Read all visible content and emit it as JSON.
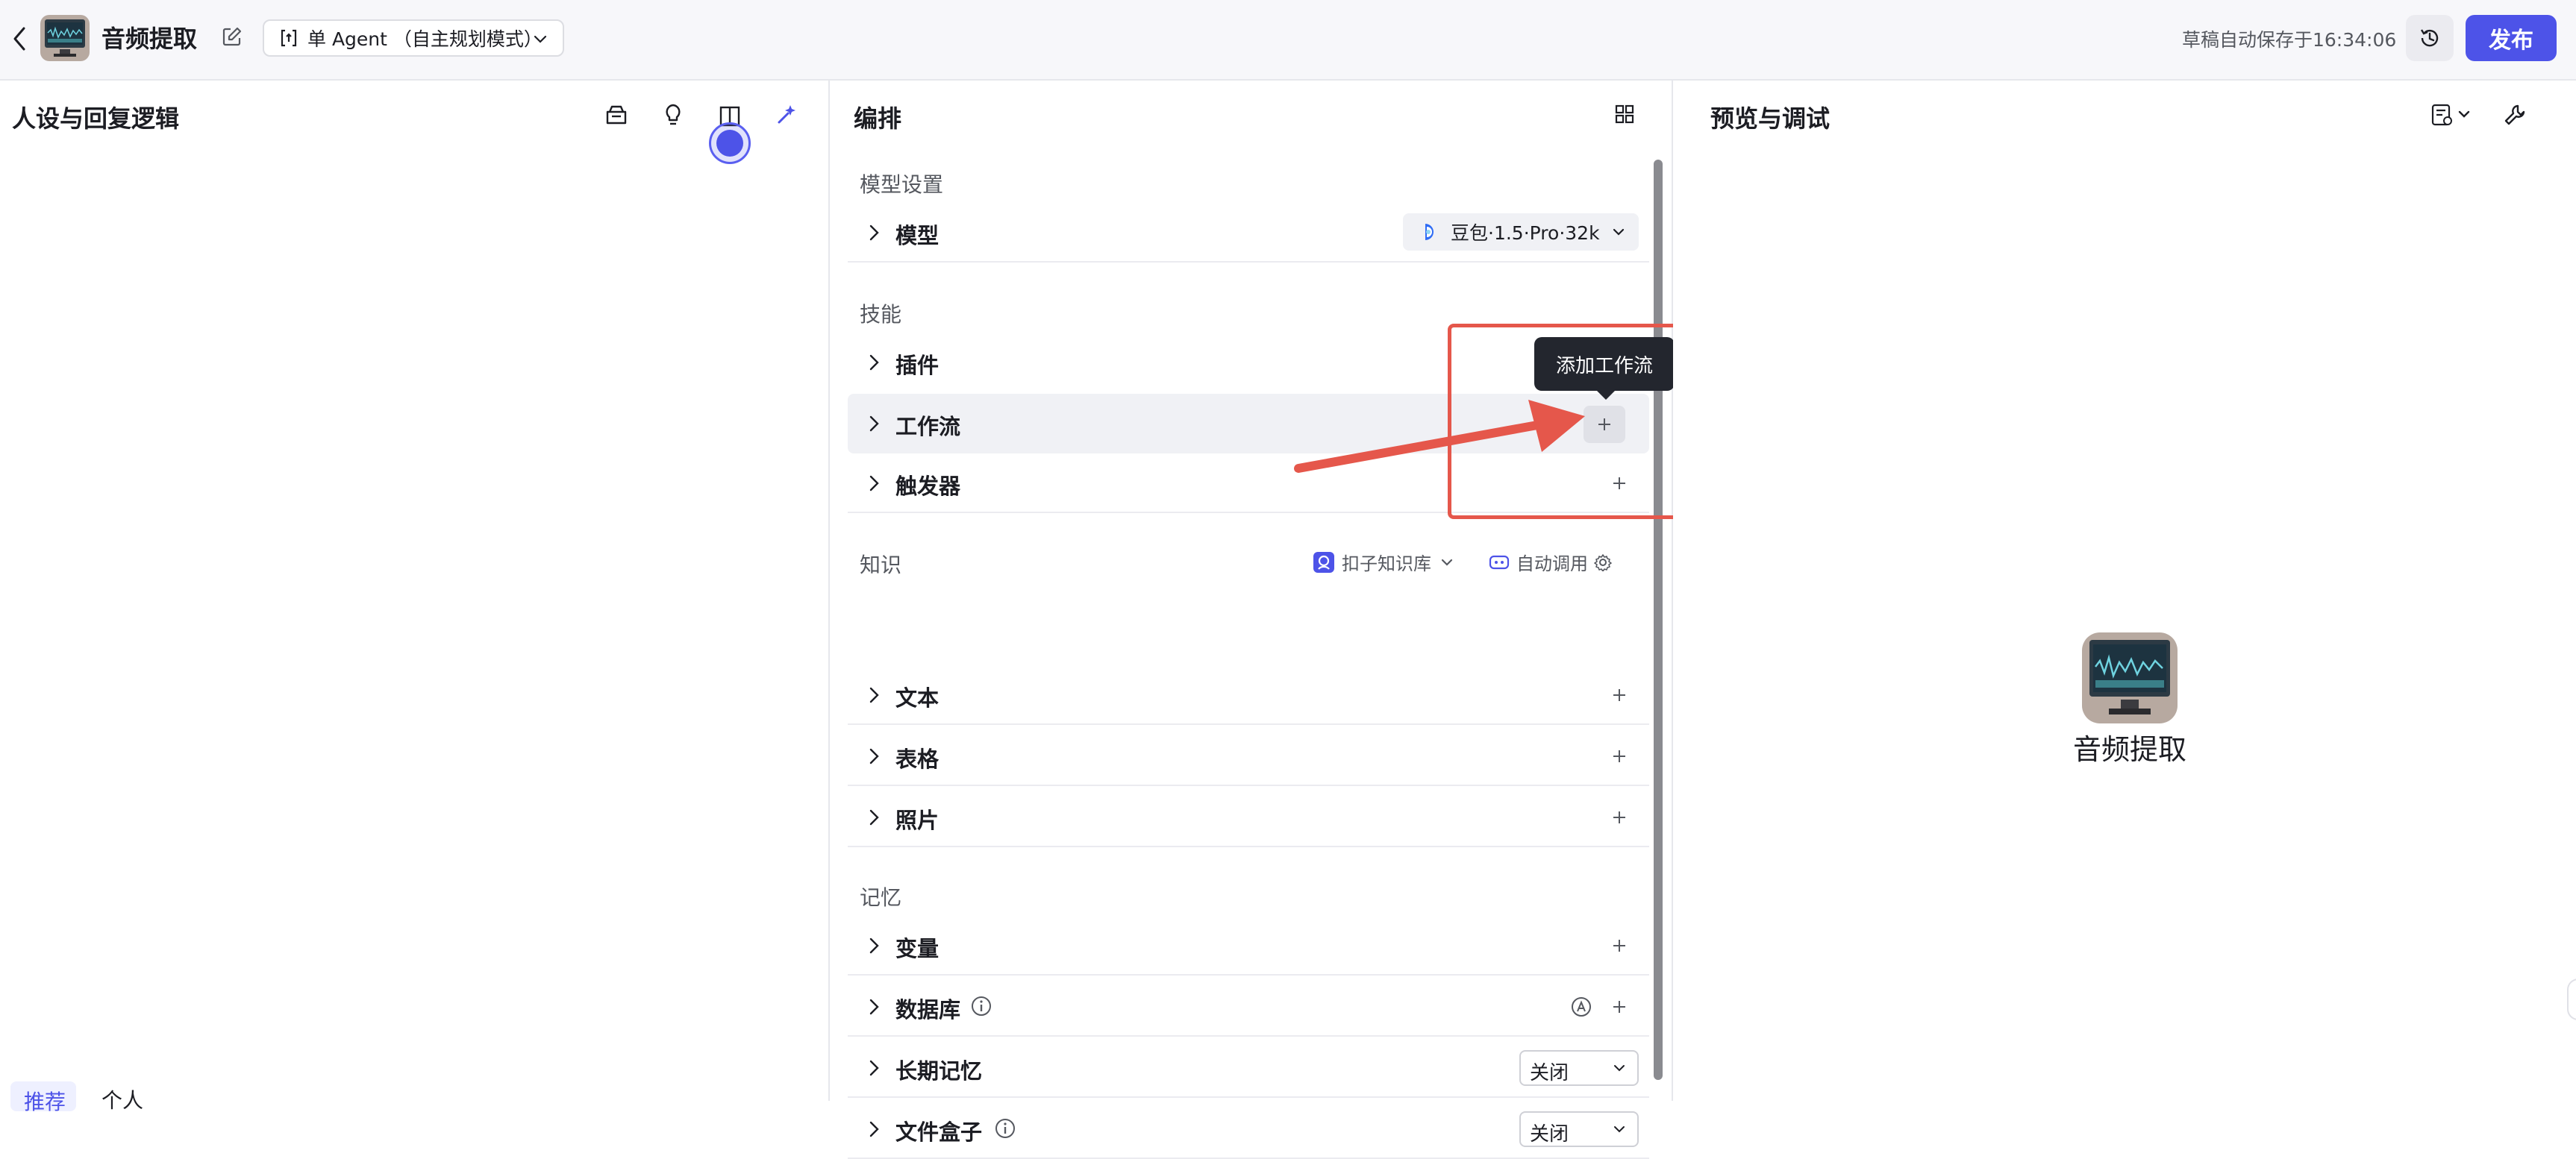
{
  "header": {
    "app_name": "音频提取",
    "mode_label": "单 Agent （自主规划模式）",
    "save_status": "草稿自动保存于16:34:06",
    "publish_label": "发布"
  },
  "left_panel": {
    "title": "人设与回复逻辑",
    "tabs": [
      "推荐",
      "个人"
    ]
  },
  "middle_panel": {
    "title": "编排",
    "model_section": "模型设置",
    "model_row": "模型",
    "model_name": "豆包·1.5·Pro·32k",
    "skills_section": "技能",
    "skills": [
      "插件",
      "工作流",
      "触发器"
    ],
    "knowledge_section": "知识",
    "knowledge_source": "扣子知识库",
    "knowledge_mode": "自动调用",
    "knowledge_items": [
      "文本",
      "表格",
      "照片"
    ],
    "memory_section": "记忆",
    "memory_items": [
      "变量",
      "数据库",
      "长期记忆",
      "文件盒子"
    ],
    "long_memory_value": "关闭",
    "file_box_value": "关闭",
    "tooltip": "添加工作流"
  },
  "right_panel": {
    "title": "预览与调试",
    "bot_name": "音频提取"
  },
  "colors": {
    "primary": "#4d53e8",
    "annotation": "#e5574b"
  }
}
